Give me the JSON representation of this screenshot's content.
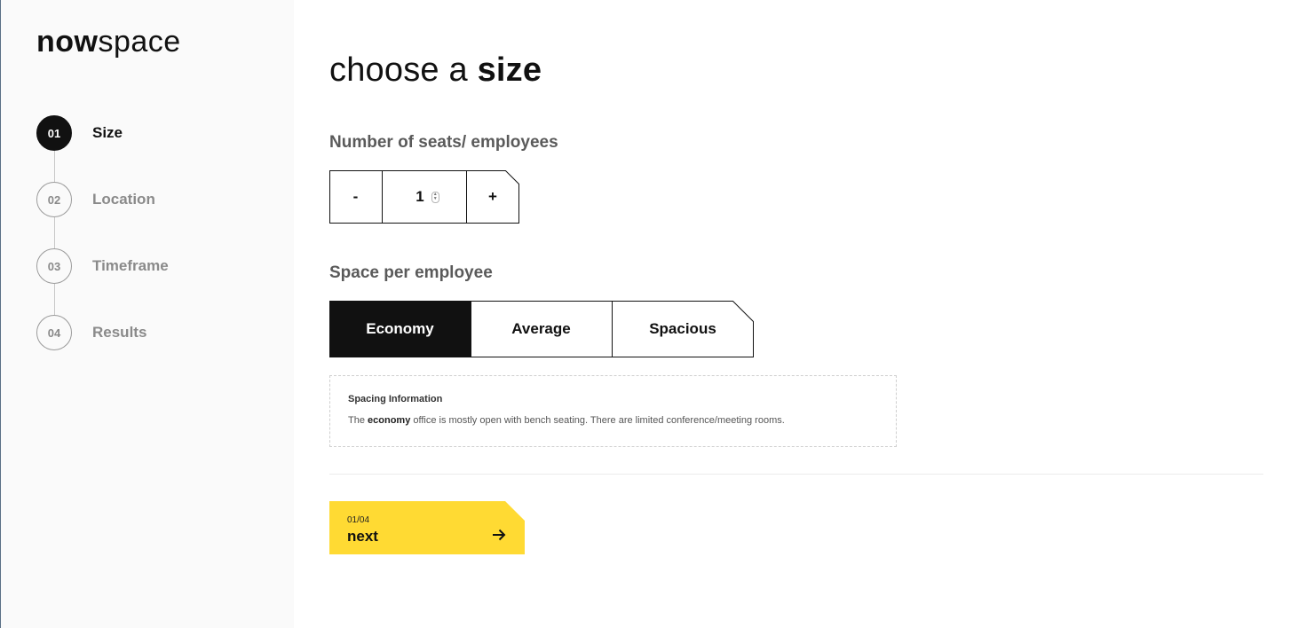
{
  "brand": {
    "bold": "now",
    "light": "space"
  },
  "steps": [
    {
      "num": "01",
      "label": "Size",
      "active": true
    },
    {
      "num": "02",
      "label": "Location",
      "active": false
    },
    {
      "num": "03",
      "label": "Timeframe",
      "active": false
    },
    {
      "num": "04",
      "label": "Results",
      "active": false
    }
  ],
  "title": {
    "regular": "choose a ",
    "bold": "size"
  },
  "seats": {
    "label": "Number of seats/ employees",
    "minus": "-",
    "value": "1",
    "plus": "+"
  },
  "space": {
    "label": "Space per employee",
    "options": [
      "Economy",
      "Average",
      "Spacious"
    ],
    "selected": "Economy"
  },
  "info": {
    "title": "Spacing Information",
    "text_before": "The ",
    "text_bold": "economy",
    "text_after": " office is mostly open with bench seating. There are limited conference/meeting rooms."
  },
  "next": {
    "step": "01/04",
    "label": "next"
  },
  "colors": {
    "accent": "#FFDA33",
    "dark": "#111111",
    "muted": "#8a8a8a"
  }
}
